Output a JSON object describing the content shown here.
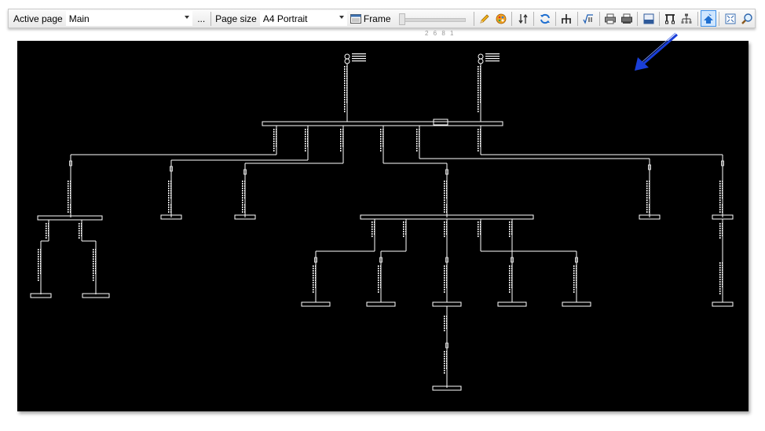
{
  "toolbar": {
    "active_page_label": "Active page",
    "active_page_value": "Main",
    "more_label": "...",
    "page_size_label": "Page size",
    "page_size_value": "A4 Portrait",
    "frame_label": "Frame",
    "slider_ticks": "2 6 8 1",
    "icons": [
      {
        "name": "pencil-icon"
      },
      {
        "name": "palette-icon"
      },
      {
        "name": "swap-icon"
      },
      {
        "name": "refresh-icon"
      },
      {
        "name": "tree-connect-icon"
      },
      {
        "name": "function-icon"
      },
      {
        "name": "print-icon"
      },
      {
        "name": "print-preview-icon"
      },
      {
        "name": "export-icon"
      },
      {
        "name": "align-icon"
      },
      {
        "name": "hierarchy-icon"
      },
      {
        "name": "auto-layout-icon",
        "active": true
      },
      {
        "name": "fit-page-icon"
      },
      {
        "name": "zoom-icon"
      }
    ]
  },
  "colors": {
    "canvas_bg": "#000000",
    "diagram_line": "#ffffff",
    "annotation_arrow": "#1a3fd8",
    "active_button_bg": "#cfe6ff"
  }
}
